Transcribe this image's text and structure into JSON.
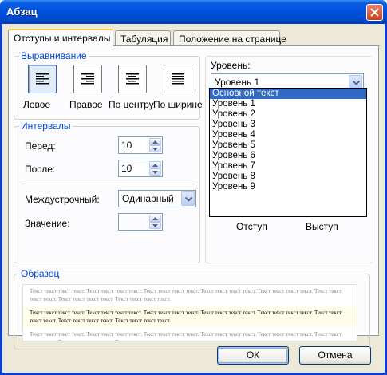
{
  "window": {
    "title": "Абзац"
  },
  "tabs": [
    "Отступы и интервалы",
    "Табуляция",
    "Положение на странице"
  ],
  "alignment": {
    "group_label": "Выравнивание",
    "selected": 0,
    "options": [
      {
        "label": "Левое",
        "icon": "align-left-icon"
      },
      {
        "label": "Правое",
        "icon": "align-right-icon"
      },
      {
        "label": "По центру",
        "icon": "align-center-icon"
      },
      {
        "label": "По ширине",
        "icon": "align-justify-icon"
      }
    ]
  },
  "level": {
    "label": "Уровень:",
    "value": "Уровень 1",
    "options": [
      "Основной текст",
      "Уровень 1",
      "Уровень 2",
      "Уровень 3",
      "Уровень 4",
      "Уровень 5",
      "Уровень 6",
      "Уровень 7",
      "Уровень 8",
      "Уровень 9"
    ],
    "highlighted": "Основной текст"
  },
  "spacing": {
    "group_label": "Интервалы",
    "before_label": "Перед:",
    "before_value": "10",
    "after_label": "После:",
    "after_value": "10",
    "line_label": "Междустрочный:",
    "line_value": "Одинарный",
    "value_label": "Значение:",
    "value_value": ""
  },
  "indent": {
    "first_line_label": "Отступ",
    "hanging_label": "Выступ"
  },
  "preview": {
    "group_label": "Образец",
    "before_text": "Текст текст текст текст. Текст текст текст текст. Текст текст текст текст. Текст текст текст текст. Текст текст текст текст. Текст текст текст текст. Текст текст текст текст. Текст текст текст текст.",
    "main_text": "Текст текст текст текст. Текст текст текст текст. Текст текст текст текст. Текст текст текст текст. Текст текст текст текст. Текст текст текст текст. Текст текст текст текст. Текст текст текст текст.",
    "after_text": "Текст текст текст текст. Текст текст текст текст. Текст текст текст текст. Текст текст текст текст. Текст текст текст текст. Текст текст текст текст. Текст текст текст текст. Текст текст текст текст."
  },
  "buttons": {
    "ok": "ОК",
    "cancel": "Отмена"
  },
  "colors": {
    "title_bar": "#0054e3",
    "group_label": "#0046d5",
    "selection": "#316ac5",
    "dialog_bg": "#ece9d8"
  }
}
